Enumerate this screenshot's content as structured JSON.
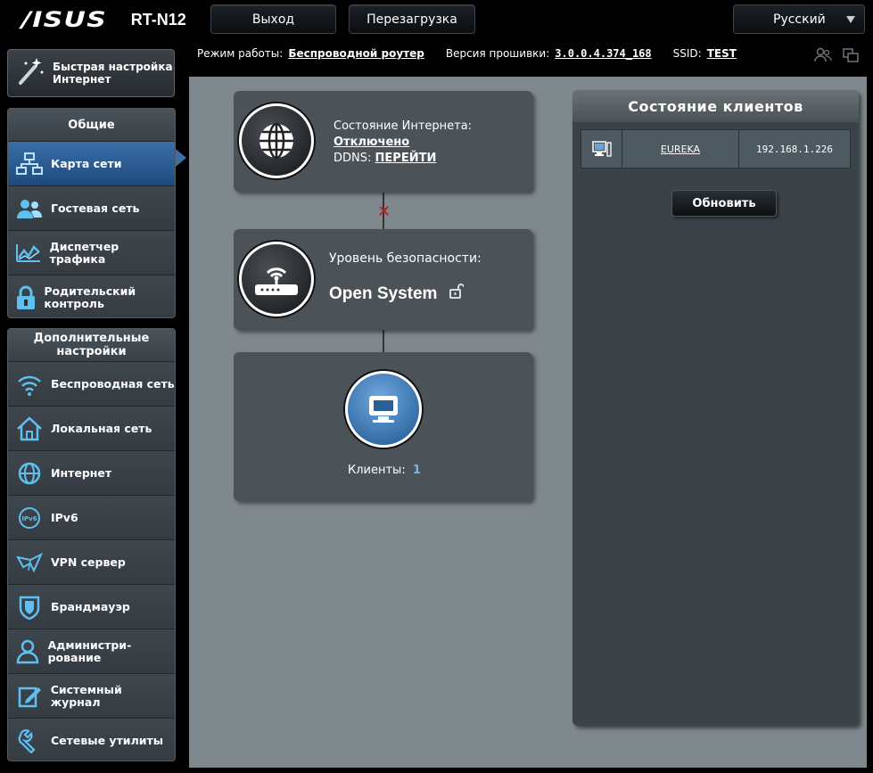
{
  "header": {
    "brand": "/ISUS",
    "model": "RT-N12",
    "logout_label": "Выход",
    "reboot_label": "Перезагрузка",
    "language": "Русский"
  },
  "infobar": {
    "mode_label": "Режим работы:",
    "mode_value": "Беспроводной роутер",
    "fw_label": "Версия прошивки:",
    "fw_value": "3.0.0.4.374_168",
    "ssid_label": "SSID:",
    "ssid_value": "TEST"
  },
  "sidebar": {
    "quick_setup": "Быстрая настройка Интернет",
    "general_title": "Общие",
    "general_items": [
      {
        "label": "Карта сети",
        "icon": "network-map-icon"
      },
      {
        "label": "Гостевая сеть",
        "icon": "guest-network-icon"
      },
      {
        "label": "Диспетчер трафика",
        "icon": "traffic-manager-icon"
      },
      {
        "label": "Родительский контроль",
        "icon": "parental-control-icon"
      }
    ],
    "advanced_title": "Дополнительные настройки",
    "advanced_items": [
      {
        "label": "Беспроводная сеть",
        "icon": "wireless-icon"
      },
      {
        "label": "Локальная сеть",
        "icon": "lan-icon"
      },
      {
        "label": "Интернет",
        "icon": "internet-icon"
      },
      {
        "label": "IPv6",
        "icon": "ipv6-icon"
      },
      {
        "label": "VPN сервер",
        "icon": "vpn-icon"
      },
      {
        "label": "Брандмауэр",
        "icon": "firewall-icon"
      },
      {
        "label": "Администри-рование",
        "icon": "administration-icon"
      },
      {
        "label": "Системный журнал",
        "icon": "system-log-icon"
      },
      {
        "label": "Сетевые утилиты",
        "icon": "network-tools-icon"
      }
    ]
  },
  "map": {
    "internet_status_label": "Состояние Интернета:",
    "internet_status_value": "Отключено",
    "ddns_label": "DDNS:",
    "ddns_link": "ПЕРЕЙТИ",
    "security_label": "Уровень безопасности:",
    "security_value": "Open System",
    "clients_label": "Клиенты:",
    "clients_count": "1"
  },
  "client_panel": {
    "title": "Состояние клиентов",
    "clients": [
      {
        "name": "EUREKA",
        "ip": "192.168.1.226"
      }
    ],
    "refresh_label": "Обновить"
  },
  "colors": {
    "active_nav": "#2f64a0",
    "disconnected_x": "#c41818",
    "client_count": "#7fb2e8"
  }
}
